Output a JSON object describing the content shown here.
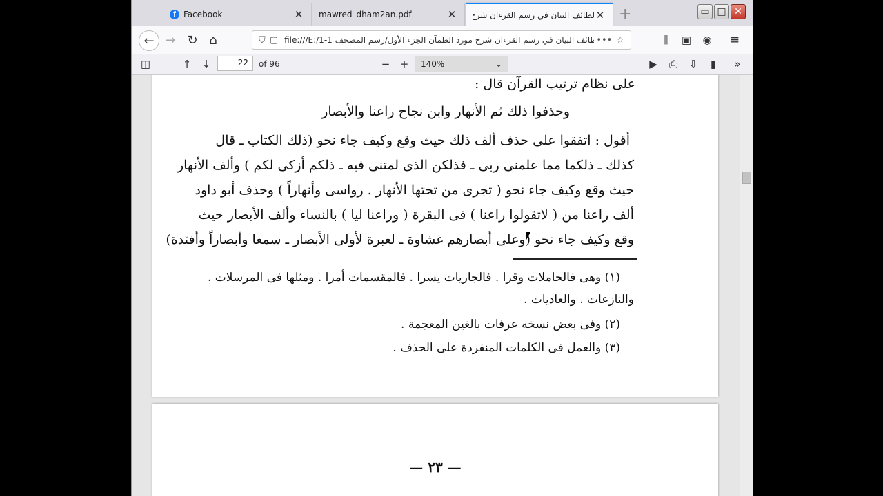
{
  "tabs": [
    {
      "label": "Facebook",
      "icon": "facebook-icon"
    },
    {
      "label": "mawred_dham2an.pdf"
    },
    {
      "label": "لطائف البيان في رسم القرءان شرح مورد"
    }
  ],
  "navbar": {
    "url": "file:///E:/1-1 لطائف البيان في رسم القرءان شرح مورد الظمآن الجزء الأول/رسم المصحف/...",
    "menu_dots": "•••"
  },
  "pdf_toolbar": {
    "page_number": "22",
    "page_count": "of 96",
    "zoom": "140%"
  },
  "document": {
    "lines": [
      "على نظام ترتيب القرآن قال :",
      "وحذفوا ذلك ثم الأنهار     وابن نجاح راعنا والأبصار",
      "أقول : اتفقوا على حذف ألف ذلك حيث وقع وكيف جاء نحو (ذلك الكتاب ـ قال",
      "كذلك ـ ذلكما مما علمنى ربى ـ فذلكن الذى لمتنى فيه ـ ذلكم أزكى لكم ) وألف الأنهار",
      "حيث وقع وكيف جاء نحو ( تجرى من تحتها الأنهار . رواسى وأنهاراً ) وحذف أبو داود",
      "ألف راعنا من ( لاتقولوا راعنا ) فى البقرة ( وراعنا ليا ) بالنساء وألف الأبصار حيث",
      "وقع وكيف جاء نحو (وعلى أبصارهم غشاوة ـ لعبرة لأولى الأبصار ـ سمعا وأبصاراً وأفئدة)"
    ],
    "footnotes": [
      "(١) وهى فالحاملات وقرا . فالجاريات يسرا . فالمقسمات أمرا . ومثلها فى المرسلات .",
      "والنازعات . والعاديات .",
      "(٢) وفى بعض نسخه عرفات بالغين المعجمة .",
      "(٣) والعمل فى الكلمات المنفردة على الحذف ."
    ],
    "next_page_number": "— ٢٣ —"
  }
}
